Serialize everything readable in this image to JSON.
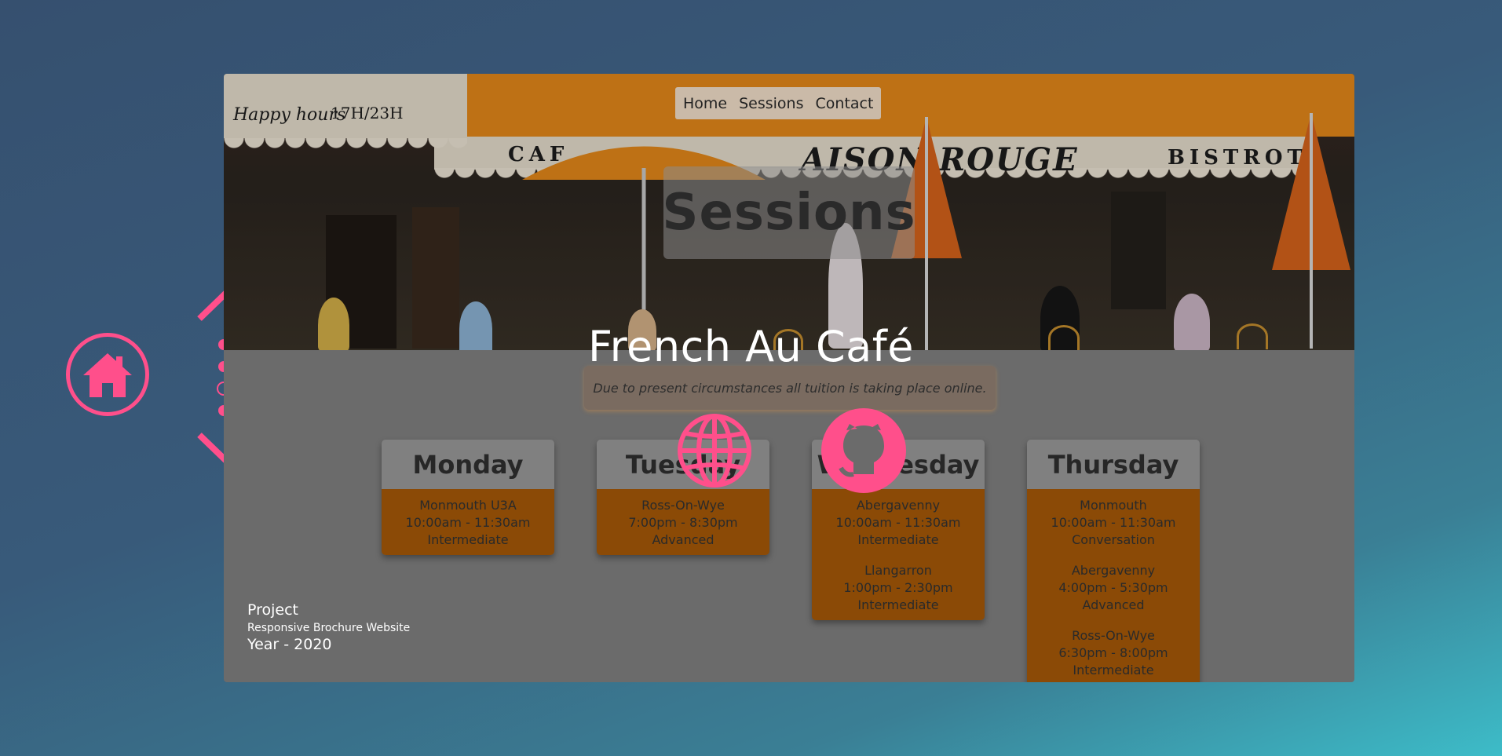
{
  "card": {
    "nav": {
      "items": [
        "Home",
        "Sessions",
        "Contact"
      ]
    },
    "hero": {
      "heading": "Sessions",
      "signs": [
        "Happy hours",
        "17H/23H",
        "CAF",
        "AISON ROUGE",
        "BISTROT"
      ]
    },
    "notice": "Due to present circumstances all tuition is taking place online.",
    "schedule": [
      {
        "day": "Monday",
        "sessions": [
          [
            "Monmouth U3A",
            "10:00am - 11:30am",
            "Intermediate"
          ]
        ]
      },
      {
        "day": "Tuesday",
        "sessions": [
          [
            "Ross-On-Wye",
            "7:00pm - 8:30pm",
            "Advanced"
          ]
        ]
      },
      {
        "day": "Wednesday",
        "sessions": [
          [
            "Abergavenny",
            "10:00am - 11:30am",
            "Intermediate"
          ],
          [
            "Llangarron",
            "1:00pm - 2:30pm",
            "Intermediate"
          ]
        ]
      },
      {
        "day": "Thursday",
        "sessions": [
          [
            "Monmouth",
            "10:00am - 11:30am",
            "Conversation"
          ],
          [
            "Abergavenny",
            "4:00pm - 5:30pm",
            "Advanced"
          ],
          [
            "Ross-On-Wye",
            "6:30pm - 8:00pm",
            "Intermediate"
          ]
        ]
      }
    ],
    "project": {
      "label": "Project",
      "description": "Responsive Brochure Website",
      "year": "Year - 2020"
    }
  },
  "overlay": {
    "title": "French Au Café"
  },
  "icons": {
    "home": "home-icon",
    "up": "chevron-up-icon",
    "down": "chevron-down-icon",
    "website": "globe-icon",
    "repo": "github-icon"
  },
  "colors": {
    "accent": "#ff4f8b",
    "session_bg": "#8b4a06",
    "awning": "#e88a1a"
  }
}
